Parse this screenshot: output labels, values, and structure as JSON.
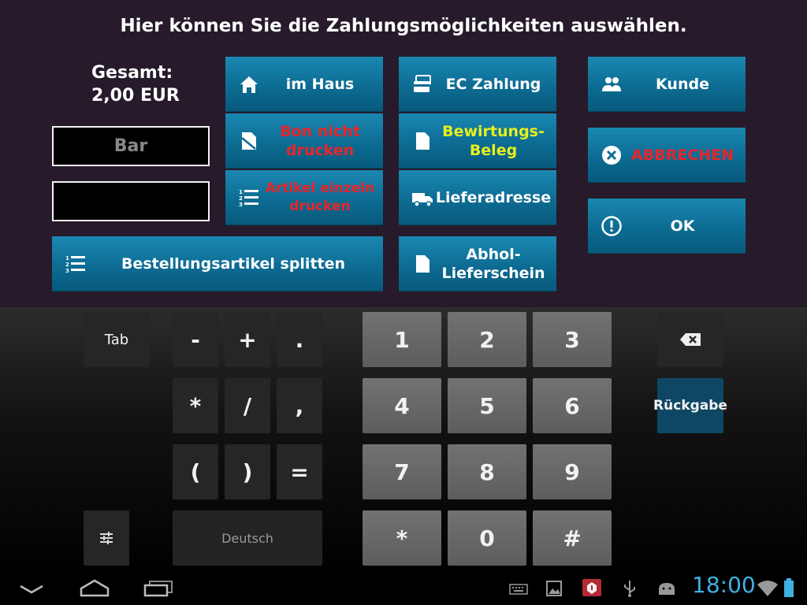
{
  "header": {
    "title": "Hier können Sie die Zahlungsmöglichkeiten auswählen."
  },
  "total": {
    "label": "Gesamt:",
    "amount": "2,00 EUR"
  },
  "fields": {
    "payment_method": "Bar",
    "second": ""
  },
  "buttons": {
    "im_haus": "im Haus",
    "ec_zahlung": "EC Zahlung",
    "kunde": "Kunde",
    "bon_nicht_drucken": "Bon nicht drucken",
    "bewirtungs_beleg": "Bewirtungs-Beleg",
    "abbrechen": "ABBRECHEN",
    "artikel_einzeln_drucken": "Artikel einzeln drucken",
    "lieferadresse": "Lieferadresse",
    "ok": "OK",
    "bestellungsartikel_splitten": "Bestellungsartikel splitten",
    "abhol_lieferschein": "Abhol-Lieferschein"
  },
  "keyboard": {
    "tab": "Tab",
    "minus": "-",
    "plus": "+",
    "dot": ".",
    "asterisk": "*",
    "slash": "/",
    "comma": ",",
    "paren_open": "(",
    "paren_close": ")",
    "equals": "=",
    "language": "Deutsch",
    "digits": [
      "1",
      "2",
      "3",
      "4",
      "5",
      "6",
      "7",
      "8",
      "9"
    ],
    "num_star": "*",
    "zero": "0",
    "hash": "#",
    "return": "Rückgabe"
  },
  "status_bar": {
    "time": "18:00"
  },
  "colors": {
    "accent_blue": "#0d6c93",
    "danger_red": "#e8252a",
    "highlight_yellow": "#e7f01c",
    "clock_blue": "#3fb0e0"
  }
}
